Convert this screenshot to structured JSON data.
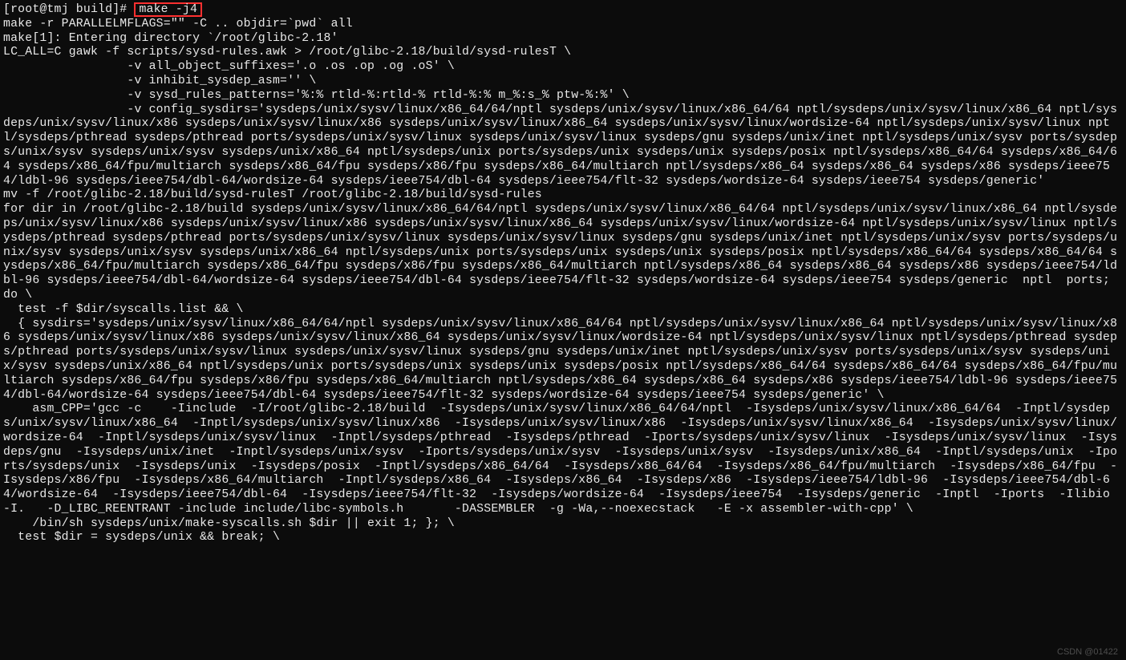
{
  "prompt_user": "[root@tmj build]# ",
  "prompt_cmd": "make -j4",
  "body": "make -r PARALLELMFLAGS=\"\" -C .. objdir=`pwd` all\nmake[1]: Entering directory `/root/glibc-2.18'\nLC_ALL=C gawk -f scripts/sysd-rules.awk > /root/glibc-2.18/build/sysd-rulesT \\\n                 -v all_object_suffixes='.o .os .op .og .oS' \\\n                 -v inhibit_sysdep_asm='' \\\n                 -v sysd_rules_patterns='%:% rtld-%:rtld-% rtld-%:% m_%:s_% ptw-%:%' \\\n                 -v config_sysdirs='sysdeps/unix/sysv/linux/x86_64/64/nptl sysdeps/unix/sysv/linux/x86_64/64 nptl/sysdeps/unix/sysv/linux/x86_64 nptl/sysdeps/unix/sysv/linux/x86 sysdeps/unix/sysv/linux/x86 sysdeps/unix/sysv/linux/x86_64 sysdeps/unix/sysv/linux/wordsize-64 nptl/sysdeps/unix/sysv/linux nptl/sysdeps/pthread sysdeps/pthread ports/sysdeps/unix/sysv/linux sysdeps/unix/sysv/linux sysdeps/gnu sysdeps/unix/inet nptl/sysdeps/unix/sysv ports/sysdeps/unix/sysv sysdeps/unix/sysv sysdeps/unix/x86_64 nptl/sysdeps/unix ports/sysdeps/unix sysdeps/unix sysdeps/posix nptl/sysdeps/x86_64/64 sysdeps/x86_64/64 sysdeps/x86_64/fpu/multiarch sysdeps/x86_64/fpu sysdeps/x86/fpu sysdeps/x86_64/multiarch nptl/sysdeps/x86_64 sysdeps/x86_64 sysdeps/x86 sysdeps/ieee754/ldbl-96 sysdeps/ieee754/dbl-64/wordsize-64 sysdeps/ieee754/dbl-64 sysdeps/ieee754/flt-32 sysdeps/wordsize-64 sysdeps/ieee754 sysdeps/generic'\nmv -f /root/glibc-2.18/build/sysd-rulesT /root/glibc-2.18/build/sysd-rules\nfor dir in /root/glibc-2.18/build sysdeps/unix/sysv/linux/x86_64/64/nptl sysdeps/unix/sysv/linux/x86_64/64 nptl/sysdeps/unix/sysv/linux/x86_64 nptl/sysdeps/unix/sysv/linux/x86 sysdeps/unix/sysv/linux/x86 sysdeps/unix/sysv/linux/x86_64 sysdeps/unix/sysv/linux/wordsize-64 nptl/sysdeps/unix/sysv/linux nptl/sysdeps/pthread sysdeps/pthread ports/sysdeps/unix/sysv/linux sysdeps/unix/sysv/linux sysdeps/gnu sysdeps/unix/inet nptl/sysdeps/unix/sysv ports/sysdeps/unix/sysv sysdeps/unix/sysv sysdeps/unix/x86_64 nptl/sysdeps/unix ports/sysdeps/unix sysdeps/unix sysdeps/posix nptl/sysdeps/x86_64/64 sysdeps/x86_64/64 sysdeps/x86_64/fpu/multiarch sysdeps/x86_64/fpu sysdeps/x86/fpu sysdeps/x86_64/multiarch nptl/sysdeps/x86_64 sysdeps/x86_64 sysdeps/x86 sysdeps/ieee754/ldbl-96 sysdeps/ieee754/dbl-64/wordsize-64 sysdeps/ieee754/dbl-64 sysdeps/ieee754/flt-32 sysdeps/wordsize-64 sysdeps/ieee754 sysdeps/generic  nptl  ports; do \\\n  test -f $dir/syscalls.list && \\\n  { sysdirs='sysdeps/unix/sysv/linux/x86_64/64/nptl sysdeps/unix/sysv/linux/x86_64/64 nptl/sysdeps/unix/sysv/linux/x86_64 nptl/sysdeps/unix/sysv/linux/x86 sysdeps/unix/sysv/linux/x86 sysdeps/unix/sysv/linux/x86_64 sysdeps/unix/sysv/linux/wordsize-64 nptl/sysdeps/unix/sysv/linux nptl/sysdeps/pthread sysdeps/pthread ports/sysdeps/unix/sysv/linux sysdeps/unix/sysv/linux sysdeps/gnu sysdeps/unix/inet nptl/sysdeps/unix/sysv ports/sysdeps/unix/sysv sysdeps/unix/sysv sysdeps/unix/x86_64 nptl/sysdeps/unix ports/sysdeps/unix sysdeps/unix sysdeps/posix nptl/sysdeps/x86_64/64 sysdeps/x86_64/64 sysdeps/x86_64/fpu/multiarch sysdeps/x86_64/fpu sysdeps/x86/fpu sysdeps/x86_64/multiarch nptl/sysdeps/x86_64 sysdeps/x86_64 sysdeps/x86 sysdeps/ieee754/ldbl-96 sysdeps/ieee754/dbl-64/wordsize-64 sysdeps/ieee754/dbl-64 sysdeps/ieee754/flt-32 sysdeps/wordsize-64 sysdeps/ieee754 sysdeps/generic' \\\n    asm_CPP='gcc -c    -Iinclude  -I/root/glibc-2.18/build  -Isysdeps/unix/sysv/linux/x86_64/64/nptl  -Isysdeps/unix/sysv/linux/x86_64/64  -Inptl/sysdeps/unix/sysv/linux/x86_64  -Inptl/sysdeps/unix/sysv/linux/x86  -Isysdeps/unix/sysv/linux/x86  -Isysdeps/unix/sysv/linux/x86_64  -Isysdeps/unix/sysv/linux/wordsize-64  -Inptl/sysdeps/unix/sysv/linux  -Inptl/sysdeps/pthread  -Isysdeps/pthread  -Iports/sysdeps/unix/sysv/linux  -Isysdeps/unix/sysv/linux  -Isysdeps/gnu  -Isysdeps/unix/inet  -Inptl/sysdeps/unix/sysv  -Iports/sysdeps/unix/sysv  -Isysdeps/unix/sysv  -Isysdeps/unix/x86_64  -Inptl/sysdeps/unix  -Iports/sysdeps/unix  -Isysdeps/unix  -Isysdeps/posix  -Inptl/sysdeps/x86_64/64  -Isysdeps/x86_64/64  -Isysdeps/x86_64/fpu/multiarch  -Isysdeps/x86_64/fpu  -Isysdeps/x86/fpu  -Isysdeps/x86_64/multiarch  -Inptl/sysdeps/x86_64  -Isysdeps/x86_64  -Isysdeps/x86  -Isysdeps/ieee754/ldbl-96  -Isysdeps/ieee754/dbl-64/wordsize-64  -Isysdeps/ieee754/dbl-64  -Isysdeps/ieee754/flt-32  -Isysdeps/wordsize-64  -Isysdeps/ieee754  -Isysdeps/generic  -Inptl  -Iports  -Ilibio -I.   -D_LIBC_REENTRANT -include include/libc-symbols.h       -DASSEMBLER  -g -Wa,--noexecstack   -E -x assembler-with-cpp' \\\n    /bin/sh sysdeps/unix/make-syscalls.sh $dir || exit 1; }; \\\n  test $dir = sysdeps/unix && break; \\",
  "watermark": "CSDN @01422"
}
